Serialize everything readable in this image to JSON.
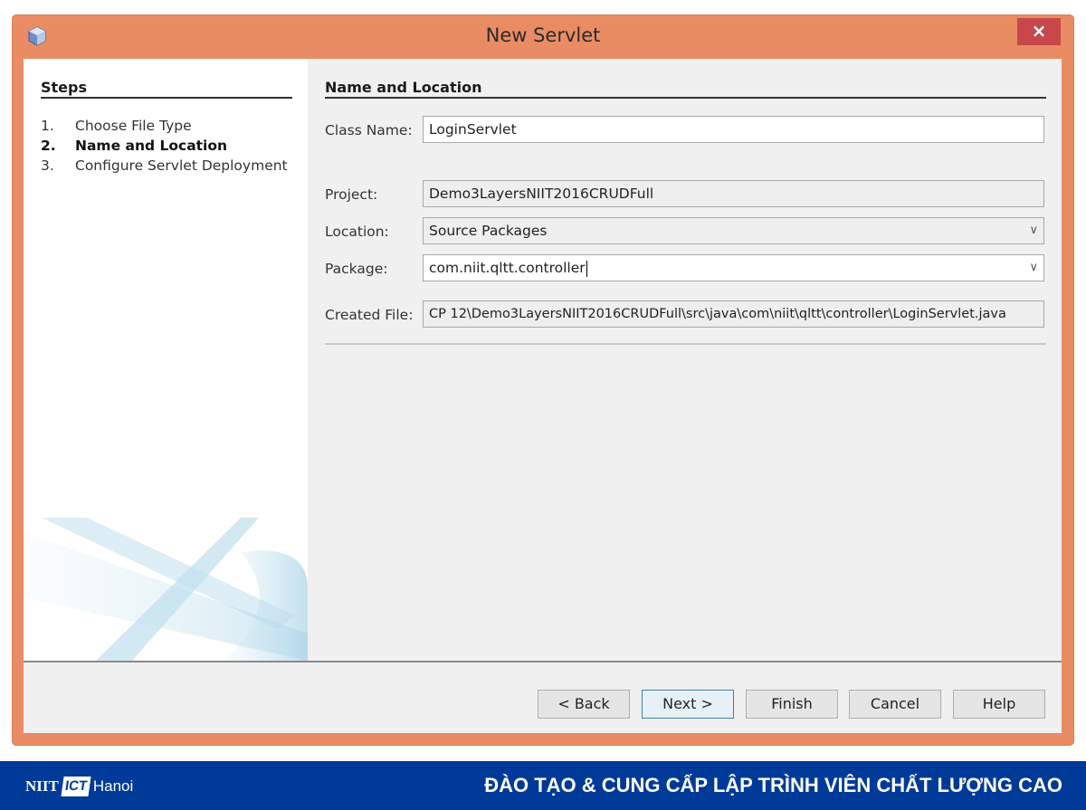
{
  "window": {
    "title": "New Servlet",
    "app_icon": "netbeans-cube-icon",
    "close_label": "×"
  },
  "steps": {
    "title": "Steps",
    "items": [
      {
        "num": "1.",
        "label": "Choose File Type",
        "active": false
      },
      {
        "num": "2.",
        "label": "Name and Location",
        "active": true
      },
      {
        "num": "3.",
        "label": "Configure Servlet Deployment",
        "active": false
      }
    ]
  },
  "form": {
    "section_title": "Name and Location",
    "class_name": {
      "label": "Class Name:",
      "value": "LoginServlet"
    },
    "project": {
      "label": "Project:",
      "value": "Demo3LayersNIIT2016CRUDFull"
    },
    "location": {
      "label": "Location:",
      "value": "Source Packages"
    },
    "package": {
      "label": "Package:",
      "value": "com.niit.qltt.controller"
    },
    "created_file": {
      "label": "Created File:",
      "value": "CP 12\\Demo3LayersNIIT2016CRUDFull\\src\\java\\com\\niit\\qltt\\controller\\LoginServlet.java"
    }
  },
  "buttons": {
    "back": "< Back",
    "next": "Next >",
    "finish": "Finish",
    "cancel": "Cancel",
    "help": "Help"
  },
  "banner": {
    "logo_left": "NIIT",
    "logo_mid": "ICT",
    "logo_right": "Hanoi",
    "slogan": "ĐÀO TẠO & CUNG CẤP LẬP TRÌNH VIÊN CHẤT LƯỢNG CAO"
  },
  "colors": {
    "window_frame": "#e98c64",
    "close_button": "#c7474a",
    "banner": "#003a98"
  }
}
